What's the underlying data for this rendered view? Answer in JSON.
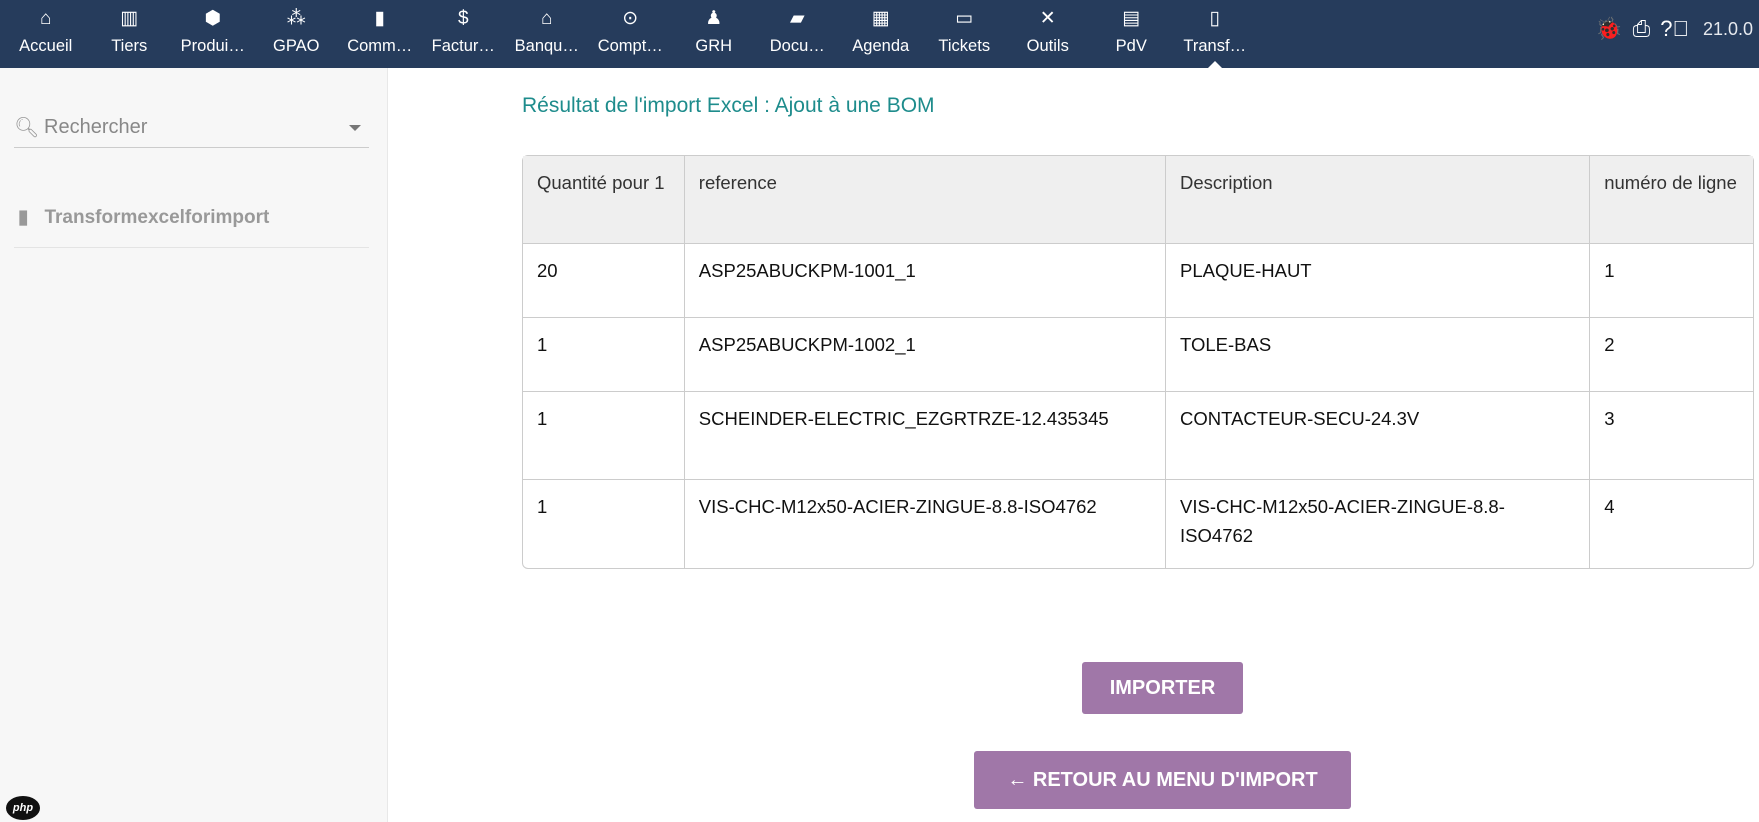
{
  "nav": [
    {
      "label": "Accueil",
      "icon": "home-icon",
      "glyph": "⌂"
    },
    {
      "label": "Tiers",
      "icon": "building-icon",
      "glyph": "▥"
    },
    {
      "label": "Produi…",
      "icon": "cube-icon",
      "glyph": "⬢"
    },
    {
      "label": "GPAO",
      "icon": "cubes-icon",
      "glyph": "⁂"
    },
    {
      "label": "Comm…",
      "icon": "suitcase-icon",
      "glyph": "▮"
    },
    {
      "label": "Factur…",
      "icon": "invoice-icon",
      "glyph": "$"
    },
    {
      "label": "Banqu…",
      "icon": "bank-icon",
      "glyph": "⌂"
    },
    {
      "label": "Compt…",
      "icon": "search-dollar-icon",
      "glyph": "⊙"
    },
    {
      "label": "GRH",
      "icon": "user-tie-icon",
      "glyph": "♟"
    },
    {
      "label": "Docu…",
      "icon": "folder-open-icon",
      "glyph": "▰"
    },
    {
      "label": "Agenda",
      "icon": "calendar-icon",
      "glyph": "▦"
    },
    {
      "label": "Tickets",
      "icon": "ticket-icon",
      "glyph": "▭"
    },
    {
      "label": "Outils",
      "icon": "tools-icon",
      "glyph": "✕"
    },
    {
      "label": "PdV",
      "icon": "cash-register-icon",
      "glyph": "▤"
    },
    {
      "label": "Transf…",
      "icon": "file-icon",
      "glyph": "▯",
      "active": true
    }
  ],
  "topright": {
    "version": "21.0.0"
  },
  "sidebar": {
    "search_placeholder": "Rechercher",
    "item": "Transformexcelforimport",
    "php": "php"
  },
  "main": {
    "title": "Résultat de l'import Excel : Ajout à une BOM",
    "headers": [
      "Quantité pour 1",
      "reference",
      "Description",
      "numéro de ligne"
    ],
    "rows": [
      [
        "20",
        "ASP25ABUCKPM-1001_1",
        "PLAQUE-HAUT",
        "1"
      ],
      [
        "1",
        "ASP25ABUCKPM-1002_1",
        "TOLE-BAS",
        "2"
      ],
      [
        "1",
        "SCHEINDER-ELECTRIC_EZGRTRZE-12.435345",
        "CONTACTEUR-SECU-24.3V",
        "3"
      ],
      [
        "1",
        "VIS-CHC-M12x50-ACIER-ZINGUE-8.8-ISO4762",
        "VIS-CHC-M12x50-ACIER-ZINGUE-8.8-ISO4762",
        "4"
      ]
    ],
    "import_button": "IMPORTER",
    "back_button": "← RETOUR AU MENU D'IMPORT"
  }
}
